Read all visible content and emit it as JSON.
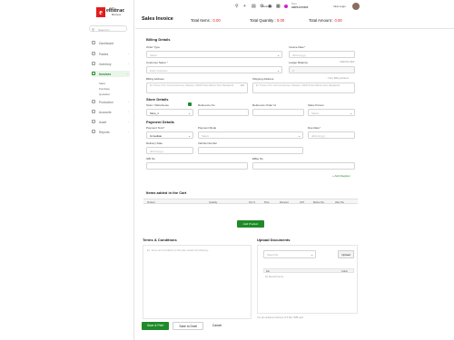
{
  "brand": {
    "logo_letter": "e",
    "name": "effitrac",
    "tagline": "Business"
  },
  "sidebar": {
    "search_placeholder": "Search in",
    "items": [
      {
        "label": "Dashboard",
        "icon": "dashboard-icon"
      },
      {
        "label": "Parties",
        "icon": "users-icon"
      },
      {
        "label": "Inventory",
        "icon": "box-icon"
      },
      {
        "label": "Invoices",
        "icon": "invoice-icon"
      },
      {
        "label": "Production",
        "icon": "factory-icon"
      },
      {
        "label": "Accounts",
        "icon": "wallet-icon"
      },
      {
        "label": "Asset",
        "icon": "asset-icon"
      },
      {
        "label": "Reports",
        "icon": "chart-icon"
      }
    ],
    "sub_items": [
      "Sales",
      "Purchase",
      "Quotation"
    ]
  },
  "topbar": {
    "store_label": "Store(s)",
    "store_caption": "Store",
    "store_name": "sales-invoice",
    "user_label": "View Login"
  },
  "header": {
    "title": "Sales Invoice",
    "total_items_label": "Total Items :",
    "total_items_value": "0.00",
    "total_quantity_label": "Total Quantity :",
    "total_quantity_value": "0.00",
    "total_amount_label": "Total Amount :",
    "total_amount_value": "0.00"
  },
  "billing": {
    "section_title": "Billing Details",
    "order_type_label": "Order Type",
    "order_type_placeholder": "Select",
    "invoice_date_label": "Invoice Date",
    "invoice_date_placeholder": "dd/mm/yyyy",
    "customer_name_label": "Customer Name",
    "customer_name_placeholder": "Enter Customer",
    "ledger_balance_label": "Ledger Balance",
    "ledger_balance_value": "0",
    "create_new": "CREATE NEW",
    "billing_address_label": "Billing Address",
    "billing_address_placeholder": "Ex: House # 01, Commercial Area, Pakistan, 44000 Phase Bahria Town Rawalpindi",
    "edit_label": "Edit",
    "shipping_address_label": "Shipping Address",
    "same_as_billing": "Copy Billing Address",
    "shipping_address_placeholder": "Ex: House # 01, Commercial Area, Pakistan, 44000 Phase Bahria Town Rawalpindi"
  },
  "store": {
    "section_title": "Store Details",
    "warehouse_label": "Store / Warehouse",
    "warehouse_value": "Store_1",
    "ref_no_label": "Reference No",
    "ref_order_label": "Reference Order Id",
    "sales_person_label": "Sales Person",
    "sales_person_placeholder": "Select"
  },
  "payment": {
    "section_title": "Payment Details",
    "payment_term_label": "Payment Term",
    "payment_term_value": "Immediate",
    "payment_mode_label": "Payment Mode",
    "payment_mode_placeholder": "Select",
    "due_date_label": "Due Date",
    "due_date_placeholder": "dd/mm/yyyy",
    "delivery_date_label": "Delivery Date",
    "delivery_date_placeholder": "dd/mm/yyyy",
    "vehicle_number_label": "Vehicle Number",
    "gbi_no_label": "GBI No",
    "ebay_no_label": "EBay No",
    "add_more": "+ Add Register"
  },
  "items_table": {
    "title": "Items added in the Cart",
    "columns": [
      "Product",
      "Quantity",
      "Tax %",
      "Price",
      "Discount",
      "GST",
      "Before Tax",
      "After Tax"
    ],
    "add_product_label": "Add Product"
  },
  "terms": {
    "title": "Terms & Conditions",
    "placeholder": "Ex. Terms and Conditions of this sale include the following..."
  },
  "upload": {
    "title": "Upload Documents",
    "select_placeholder": "Select file",
    "button_label": "Upload",
    "col_file": "File",
    "col_action": "Action",
    "empty_text": "No Record Found",
    "note": "You can upload a maximum of 5 files, 5MB each"
  },
  "actions": {
    "save_print": "Save & Print",
    "save_draft": "Save to Draft",
    "cancel": "Cancel"
  },
  "colors": {
    "accent": "#1e8a2a",
    "brand_red": "#e11d1d"
  }
}
